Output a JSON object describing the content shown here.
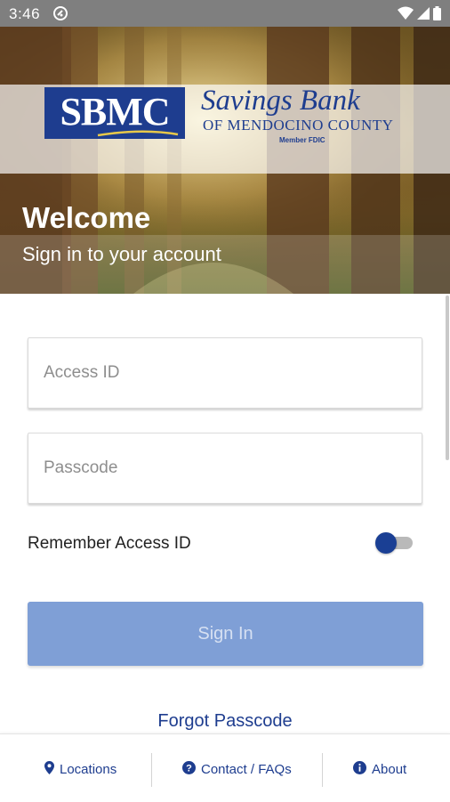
{
  "status_bar": {
    "time": "3:46",
    "icons": [
      "app-notification-icon",
      "wifi-icon",
      "signal-icon",
      "battery-icon"
    ]
  },
  "header": {
    "logo_text": "SBMC",
    "bank_name": "Savings Bank",
    "bank_subtitle": "OF MENDOCINO COUNTY",
    "fdic_text": "Member FDIC",
    "welcome": "Welcome",
    "subtitle": "Sign in to your account"
  },
  "form": {
    "access_id_placeholder": "Access ID",
    "access_id_value": "",
    "passcode_placeholder": "Passcode",
    "passcode_value": "",
    "remember_label": "Remember Access ID",
    "remember_enabled": false,
    "sign_in_label": "Sign In",
    "forgot_label": "Forgot Passcode"
  },
  "bottom_nav": {
    "locations": "Locations",
    "contact": "Contact / FAQs",
    "about": "About"
  },
  "colors": {
    "brand_blue": "#1e3d8f",
    "button_disabled": "#7f9fd6",
    "status_bar": "#7f7f7f"
  }
}
